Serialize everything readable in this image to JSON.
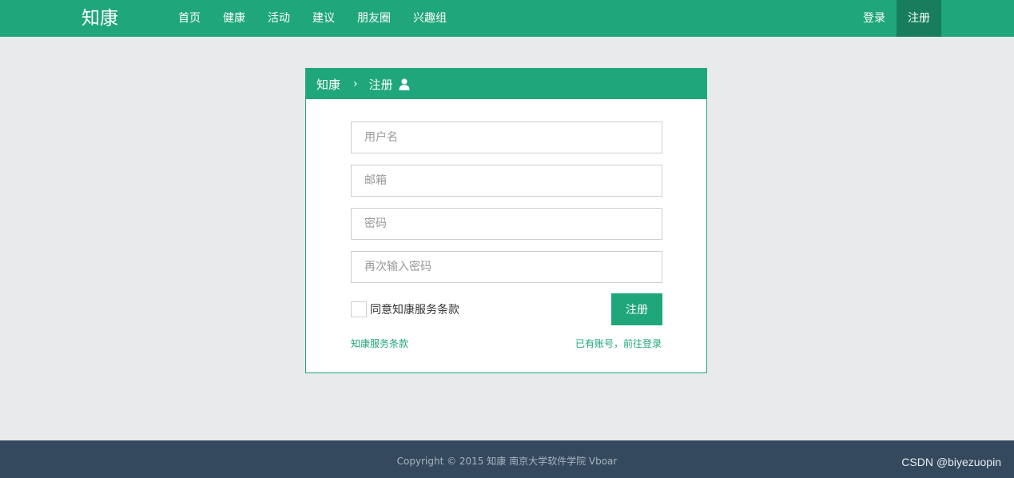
{
  "navbar": {
    "brand": "知康",
    "links": [
      "首页",
      "健康",
      "活动",
      "建议",
      "朋友圈",
      "兴趣组"
    ],
    "login": "登录",
    "register": "注册"
  },
  "panel": {
    "breadcrumb_root": "知康",
    "breadcrumb_sep": "›",
    "breadcrumb_current": "注册",
    "username_placeholder": "用户名",
    "email_placeholder": "邮箱",
    "password_placeholder": "密码",
    "confirm_placeholder": "再次输入密码",
    "agree_label": "同意知康服务条款",
    "submit_label": "注册",
    "terms_link": "知康服务条款",
    "login_link": "已有账号，前往登录"
  },
  "footer": {
    "copyright": "Copyright © 2015 知康 南京大学软件学院 Vboar",
    "watermark": "CSDN @biyezuopin"
  },
  "colors": {
    "accent": "#1fa67a",
    "accent_dark": "#187d5c",
    "footer_bg": "#34495e",
    "page_bg": "#e9eaec"
  }
}
